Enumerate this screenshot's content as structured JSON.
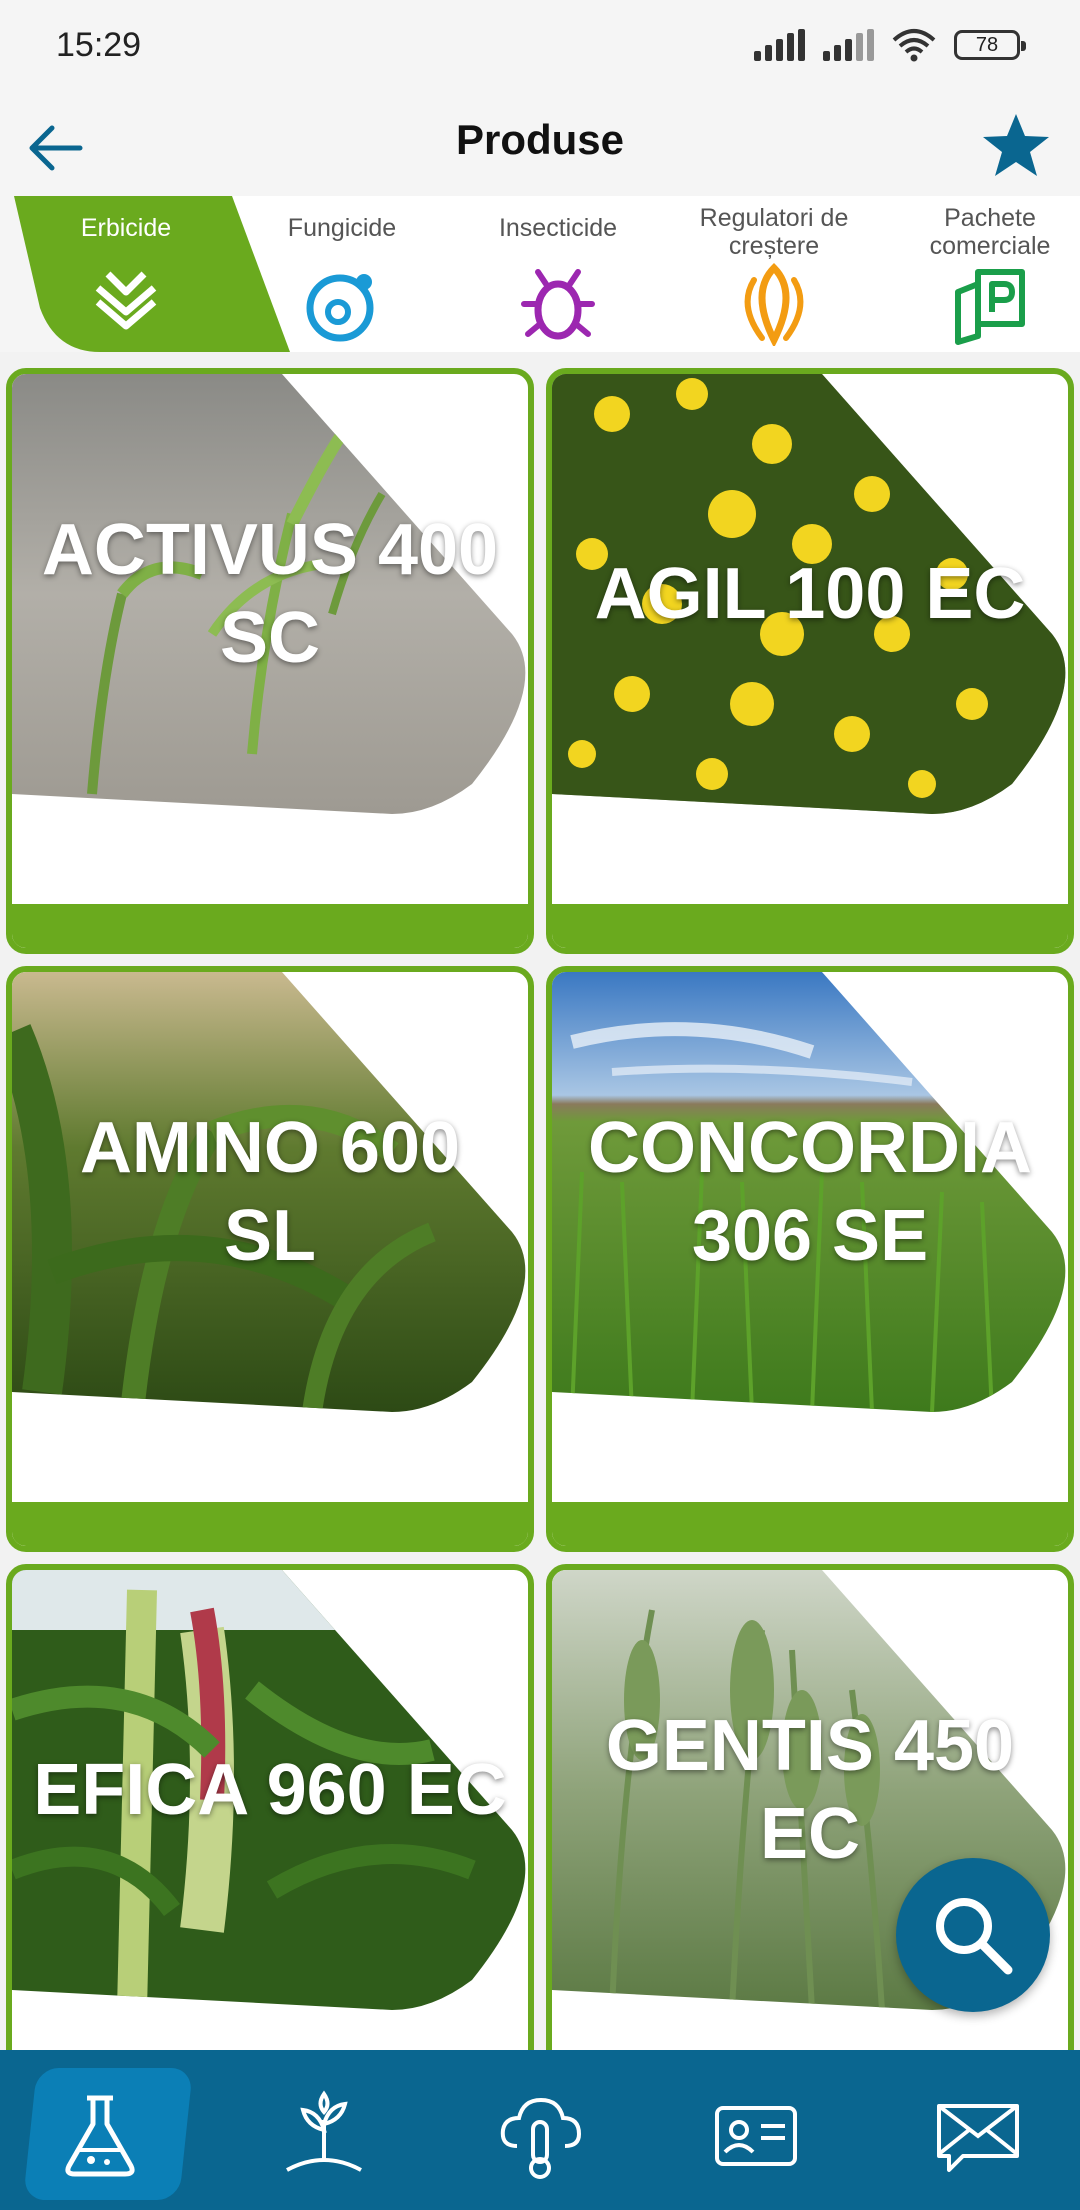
{
  "status_bar": {
    "time": "15:29",
    "battery": "78"
  },
  "app_bar": {
    "title": "Produse"
  },
  "tabs": [
    {
      "label": "Erbicide",
      "icon": "herbicide-layers-icon",
      "active": true
    },
    {
      "label": "Fungicide",
      "icon": "fungicide-spore-icon",
      "active": false
    },
    {
      "label": "Insecticide",
      "icon": "insect-bug-icon",
      "active": false
    },
    {
      "label": "Regulatori de creștere",
      "label_line1": "Regulatori de",
      "label_line2": "creștere",
      "icon": "growth-seed-icon",
      "active": false
    },
    {
      "label": "Pachete comerciale",
      "label_line1": "Pachete",
      "label_line2": "comerciale",
      "icon": "commercial-package-icon",
      "active": false
    }
  ],
  "products": [
    {
      "name": "ACTIVUS 400 SC",
      "line1": "ACTIVUS 400",
      "line2": "SC"
    },
    {
      "name": "AGIL 100 EC",
      "line1": "AGIL 100 EC",
      "line2": ""
    },
    {
      "name": "AMINO 600 SL",
      "line1": "AMINO 600",
      "line2": "SL"
    },
    {
      "name": "CONCORDIA 306 SE",
      "line1": "CONCORDIA",
      "line2": "306 SE"
    },
    {
      "name": "EFICA 960 EC",
      "line1": "EFICA 960 EC",
      "line2": ""
    },
    {
      "name": "GENTIS 450 EC",
      "line1": "GENTIS 450",
      "line2": "EC"
    }
  ],
  "colors": {
    "brand_green": "#6aaa1e",
    "brand_blue": "#0a6690",
    "active_nav": "#0b7fb6",
    "star_blue": "#0a6690"
  },
  "bottom_nav": [
    {
      "icon": "flask-icon",
      "active": true
    },
    {
      "icon": "plant-sprout-icon",
      "active": false
    },
    {
      "icon": "cloud-thermometer-icon",
      "active": false
    },
    {
      "icon": "contact-card-icon",
      "active": false
    },
    {
      "icon": "envelope-icon",
      "active": false
    }
  ]
}
